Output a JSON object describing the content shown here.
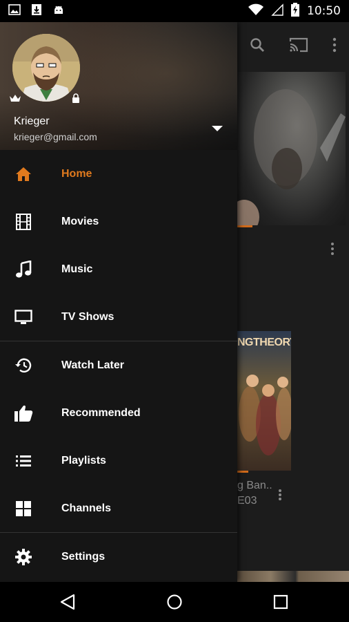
{
  "status_bar": {
    "time": "10:50",
    "left_icons": [
      "image-icon",
      "download-icon",
      "android-icon"
    ],
    "right_icons": [
      "wifi-icon",
      "signal-icon",
      "battery-charging-icon"
    ]
  },
  "background_app": {
    "toolbar_icons": [
      "search-icon",
      "cast-icon",
      "more-vert-icon"
    ],
    "tile_title": "NGTHEORY",
    "tile_caption_line1": "g Ban..",
    "tile_caption_line2": "E03"
  },
  "profile": {
    "name": "Krieger",
    "email": "krieger@gmail.com"
  },
  "menu": {
    "items": [
      {
        "label": "Home",
        "icon": "home-icon",
        "active": true
      },
      {
        "label": "Movies",
        "icon": "film-icon"
      },
      {
        "label": "Music",
        "icon": "music-note-icon"
      },
      {
        "label": "TV Shows",
        "icon": "tv-icon"
      },
      {
        "label": "Watch Later",
        "icon": "history-icon"
      },
      {
        "label": "Recommended",
        "icon": "thumb-up-icon"
      },
      {
        "label": "Playlists",
        "icon": "list-icon"
      },
      {
        "label": "Channels",
        "icon": "grid-icon"
      },
      {
        "label": "Settings",
        "icon": "gear-icon"
      }
    ]
  },
  "colors": {
    "accent": "#e07a1e",
    "drawer_bg": "#151515",
    "app_bg": "#1c1c1c"
  },
  "nav_bar": {
    "buttons": [
      "back-icon",
      "home-circle-icon",
      "recents-icon"
    ]
  }
}
